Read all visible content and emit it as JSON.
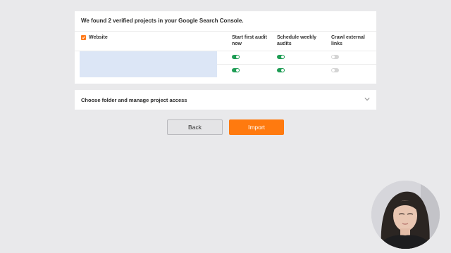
{
  "projects_card": {
    "title": "We found 2 verified projects in your Google Search Console.",
    "columns": {
      "website": "Website",
      "start_audit": "Start first audit now",
      "schedule_audits": "Schedule weekly audits",
      "crawl_external": "Crawl external links"
    },
    "select_all_checked": true,
    "rows": [
      {
        "start_audit": true,
        "schedule_audits": true,
        "crawl_external": false
      },
      {
        "start_audit": true,
        "schedule_audits": true,
        "crawl_external": false
      }
    ]
  },
  "folder_section": {
    "label": "Choose folder and manage project access"
  },
  "buttons": {
    "back": "Back",
    "import": "Import"
  },
  "colors": {
    "accent_orange": "#ff7a0f",
    "toggle_on": "#1f9d55",
    "toggle_off": "#d5d5d5",
    "row_highlight": "#dce6f6"
  },
  "icons": {
    "checkbox": "check-icon",
    "folder_expand": "chevron-down-icon"
  }
}
